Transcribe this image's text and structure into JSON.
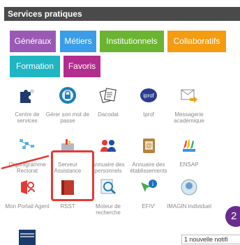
{
  "header": {
    "title": "Services pratiques"
  },
  "tabs": [
    {
      "label": "Généraux",
      "color": "#9b59b6"
    },
    {
      "label": "Métiers",
      "color": "#3b9de8"
    },
    {
      "label": "Institutionnels",
      "color": "#6ab431"
    },
    {
      "label": "Collaboratifs",
      "color": "#f39c12"
    },
    {
      "label": "Formation",
      "color": "#1fb5c2"
    },
    {
      "label": "Favoris",
      "color": "#b32d8e"
    }
  ],
  "tiles": [
    {
      "label": "Centre de services",
      "icon": "puzzle-icon"
    },
    {
      "label": "Gérer son mot de passe",
      "icon": "lock-icon"
    },
    {
      "label": "Dacodat",
      "icon": "documents-icon"
    },
    {
      "label": "Iprof",
      "icon": "iprof-logo-icon"
    },
    {
      "label": "Messagerie académique",
      "icon": "mail-arrow-icon"
    },
    {
      "label": "Organigramme Rectorat",
      "icon": "org-chart-icon"
    },
    {
      "label": "Serveur Assistance",
      "icon": "toolbox-icon"
    },
    {
      "label": "Annuaire des personnels",
      "icon": "people-icon"
    },
    {
      "label": "Annuaire des établissements",
      "icon": "address-book-icon"
    },
    {
      "label": "ENSAP",
      "icon": "hands-icon"
    },
    {
      "label": "Mon Portail Agent",
      "icon": "portal-icon"
    },
    {
      "label": "RSST",
      "icon": "register-book-icon"
    },
    {
      "label": "Moteur de recherche",
      "icon": "magnifier-icon"
    },
    {
      "label": "EFIV'",
      "icon": "info-arrow-icon"
    },
    {
      "label": "IMAGIN individuel",
      "icon": "imagin-icon"
    },
    {
      "label": "",
      "icon": "building-icon"
    }
  ],
  "notification": {
    "count": "2",
    "text": "1 nouvelle notifi"
  },
  "colors": {
    "header_bg": "#4a4a4a",
    "highlight": "#e53935",
    "label_gray": "#8a8a8a"
  }
}
